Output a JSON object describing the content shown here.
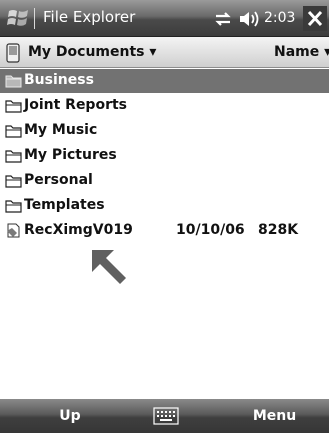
{
  "titlebar": {
    "start_icon": "windows-flag-icon",
    "title": "File Explorer",
    "connectivity_icon": "connectivity-icon",
    "volume_icon": "speaker-icon",
    "time": "2:03",
    "close_icon": "close-icon"
  },
  "dirbar": {
    "device_icon": "device-icon",
    "folder": "My Documents ▾",
    "sort": "Name ▾"
  },
  "files": [
    {
      "name": "Business",
      "icon": "folder-icon",
      "selected": true
    },
    {
      "name": "Joint Reports",
      "icon": "folder-icon"
    },
    {
      "name": "My Music",
      "icon": "folder-icon"
    },
    {
      "name": "My Pictures",
      "icon": "folder-icon"
    },
    {
      "name": "Personal",
      "icon": "folder-icon"
    },
    {
      "name": "Templates",
      "icon": "folder-icon"
    },
    {
      "name": "RecXimgV019",
      "icon": "recording-file-icon",
      "date": "10/10/06",
      "size": "828K"
    }
  ],
  "pointer_icon": "arrow-pointer-icon",
  "softkeys": {
    "left": "Up",
    "keyboard_icon": "keyboard-icon",
    "right": "Menu"
  },
  "colors": {
    "selection": "#727272",
    "titlebar": "#4a4a4a"
  }
}
